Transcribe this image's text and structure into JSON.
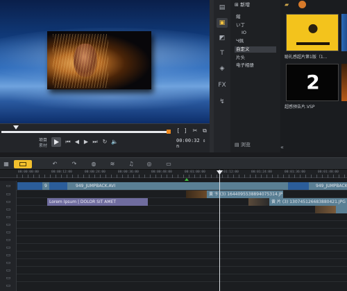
{
  "library": {
    "import_label": "新增",
    "categories": [
      "縮",
      "い丁",
      "IO",
      "Ч佩",
      "自定义",
      "片头",
      "电子相册"
    ],
    "selected_category_index": 4,
    "browse_label": "浏览",
    "thumbnails": [
      {
        "caption": "聪礼感超片第1版（1..."
      },
      {
        "number": "2",
        "caption": "超感预告片.VSP"
      }
    ]
  },
  "playback": {
    "project_label": "项目",
    "clip_label": "素材",
    "timecode": "00:00:32",
    "timecode_suffix": "n"
  },
  "ruler": {
    "ticks": [
      "00:00:00:00",
      "00:00:12:00",
      "00:00:24:00",
      "00:00:36:00",
      "00:00:48:00",
      "00:01:00:00",
      "00:01:12:00",
      "00:01:24:00",
      "00:01:36:00",
      "00:01:48:00"
    ]
  },
  "tracks": {
    "video_clip_1": "949_JUMPBACK.AVI",
    "video_clip_2": "949_JUMPBACK",
    "video_clip_marker": "9",
    "overlay1_clip": "黄 卞 (3) 1644095538894075314.JP",
    "overlay2_clip": "黄 片 (3) 13074512668388042​1.JPG",
    "title_clip": "Lorem Ipsum | DOLOR SIT AMET"
  },
  "colors": {
    "accent": "#f2c02d",
    "video_clip": "#5a7f94",
    "title_clip": "#6f6c9e",
    "scrub_marker": "#f08a1e"
  }
}
